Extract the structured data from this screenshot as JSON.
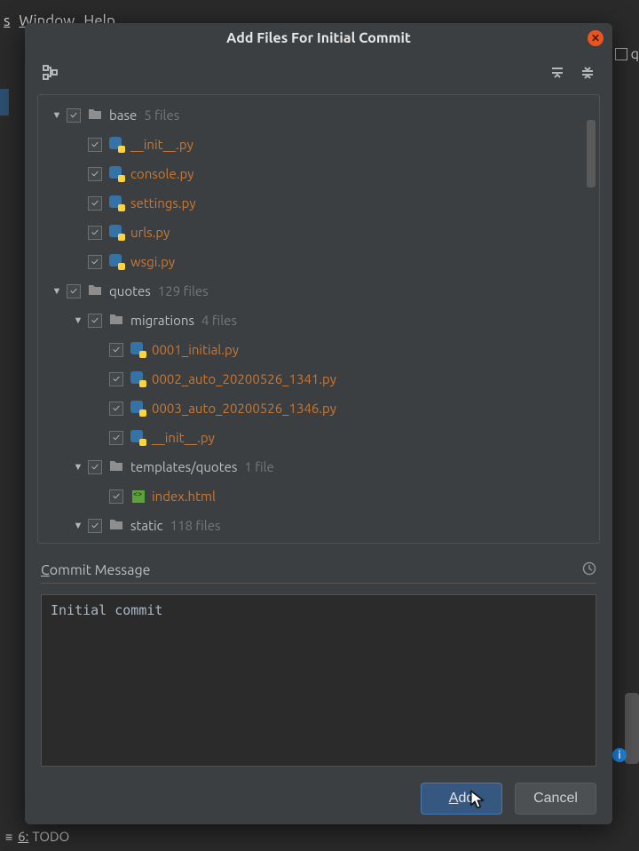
{
  "bg": {
    "menu_items": [
      "s",
      "Window",
      "Help"
    ],
    "right_tab_label": "q",
    "bottom_status_prefix": "6:",
    "bottom_status_label": "TODO"
  },
  "dialog": {
    "title": "Add Files For Initial Commit"
  },
  "toolbar": {
    "structure_tooltip": "Group by directory",
    "expand_tooltip": "Expand all",
    "collapse_tooltip": "Collapse all"
  },
  "tree": [
    {
      "indent": 1,
      "chevron": true,
      "checkbox": true,
      "type": "dir",
      "name": "base",
      "meta": "5 files"
    },
    {
      "indent": 2,
      "chevron": false,
      "checkbox": true,
      "type": "py",
      "name": "__init__.py"
    },
    {
      "indent": 2,
      "chevron": false,
      "checkbox": true,
      "type": "py",
      "name": "console.py"
    },
    {
      "indent": 2,
      "chevron": false,
      "checkbox": true,
      "type": "py",
      "name": "settings.py"
    },
    {
      "indent": 2,
      "chevron": false,
      "checkbox": true,
      "type": "py",
      "name": "urls.py"
    },
    {
      "indent": 2,
      "chevron": false,
      "checkbox": true,
      "type": "py",
      "name": "wsgi.py"
    },
    {
      "indent": 1,
      "chevron": true,
      "checkbox": true,
      "type": "dir",
      "name": "quotes",
      "meta": "129 files"
    },
    {
      "indent": 2,
      "chevron": true,
      "checkbox": true,
      "type": "dir",
      "name": "migrations",
      "meta": "4 files"
    },
    {
      "indent": 3,
      "chevron": false,
      "checkbox": true,
      "type": "py",
      "name": "0001_initial.py"
    },
    {
      "indent": 3,
      "chevron": false,
      "checkbox": true,
      "type": "py",
      "name": "0002_auto_20200526_1341.py"
    },
    {
      "indent": 3,
      "chevron": false,
      "checkbox": true,
      "type": "py",
      "name": "0003_auto_20200526_1346.py"
    },
    {
      "indent": 3,
      "chevron": false,
      "checkbox": true,
      "type": "py",
      "name": "__init__.py"
    },
    {
      "indent": 2,
      "chevron": true,
      "checkbox": true,
      "type": "dir",
      "name": "templates/quotes",
      "meta": "1 file"
    },
    {
      "indent": 3,
      "chevron": false,
      "checkbox": true,
      "type": "html",
      "name": "index.html"
    },
    {
      "indent": 2,
      "chevron": true,
      "checkbox": true,
      "type": "dir",
      "name": "static",
      "meta": "118 files"
    }
  ],
  "commit": {
    "label": "Commit Message",
    "value": "Initial commit"
  },
  "buttons": {
    "primary": "Add",
    "secondary": "Cancel"
  }
}
